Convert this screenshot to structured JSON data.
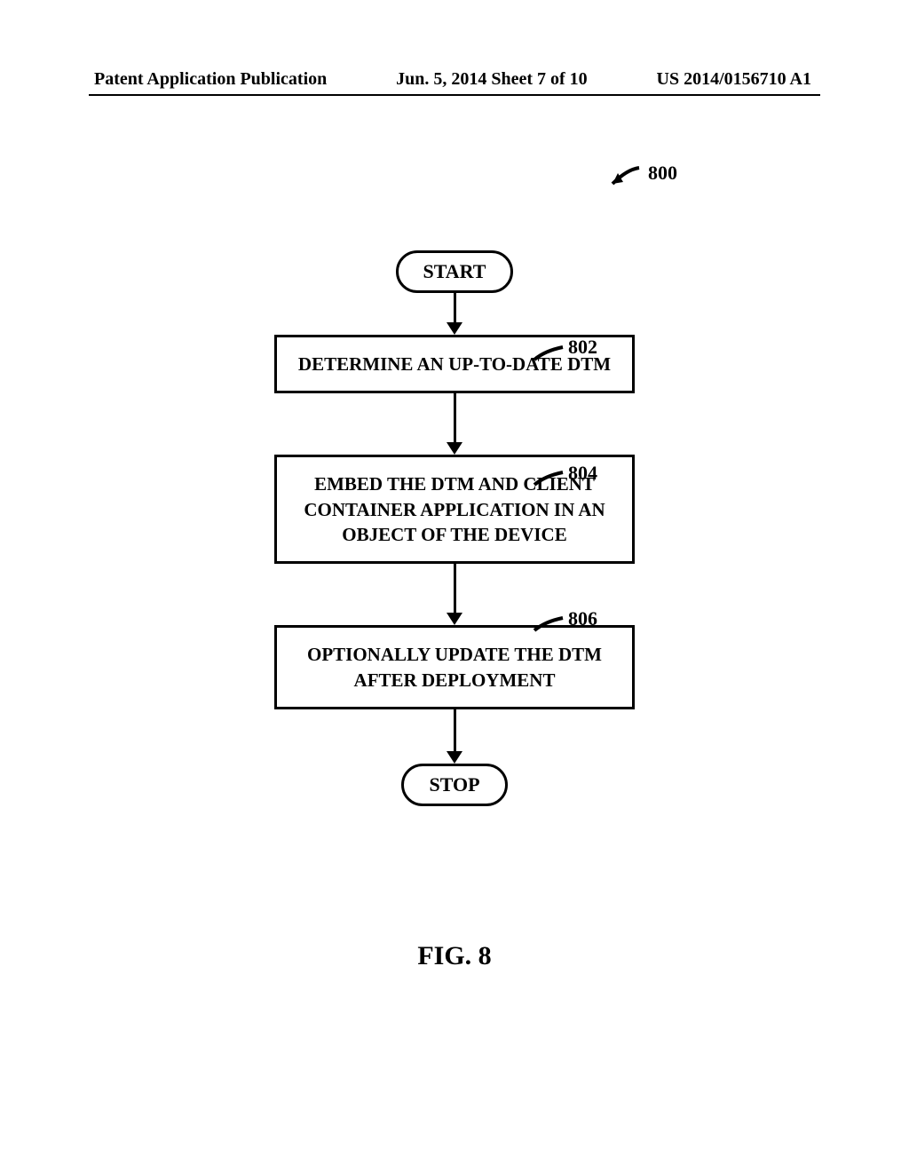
{
  "header": {
    "left": "Patent Application Publication",
    "center": "Jun. 5, 2014   Sheet 7 of 10",
    "right": "US 2014/0156710 A1"
  },
  "flowchart": {
    "figure_ref_number": "800",
    "start": "START",
    "stop": "STOP",
    "steps": [
      {
        "ref": "802",
        "text": "DETERMINE AN UP-TO-DATE DTM"
      },
      {
        "ref": "804",
        "text": "EMBED THE DTM AND CLIENT CONTAINER APPLICATION IN AN OBJECT OF THE DEVICE"
      },
      {
        "ref": "806",
        "text": "OPTIONALLY UPDATE THE DTM AFTER DEPLOYMENT"
      }
    ]
  },
  "figure_label": "FIG. 8"
}
